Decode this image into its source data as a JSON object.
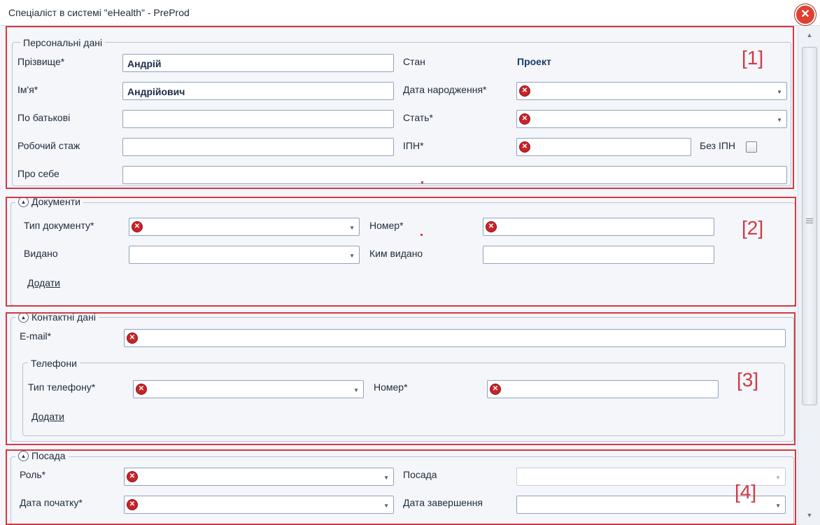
{
  "window": {
    "title": "Спеціаліст в системі \"eHealth\" - PreProd",
    "close_icon": "close-icon"
  },
  "annotations": [
    "[1]",
    "[2]",
    "[3]",
    "[4]"
  ],
  "personal": {
    "legend": "Персональні дані",
    "surname_label": "Прізвище*",
    "surname_value": "Андрій",
    "name_label": "Ім'я*",
    "name_value": "Андрійович",
    "patronymic_label": "По батькові",
    "patronymic_value": "",
    "experience_label": "Робочий стаж",
    "experience_value": "",
    "about_label": "Про себе",
    "about_value": "",
    "status_label": "Стан",
    "status_value": "Проект",
    "birthdate_label": "Дата народження*",
    "gender_label": "Стать*",
    "tax_id_label": "ІПН*",
    "no_tax_id_label": "Без ІПН",
    "no_tax_id_checked": false
  },
  "documents": {
    "legend": "Документи",
    "doc_type_label": "Тип документу*",
    "number_label": "Номер*",
    "issued_label": "Видано",
    "issued_by_label": "Ким видано",
    "add_link": "Додати"
  },
  "contacts": {
    "legend": "Контактні дані",
    "email_label": "E-mail*",
    "phones": {
      "legend": "Телефони",
      "phone_type_label": "Тип телефону*",
      "number_label": "Номер*",
      "add_link": "Додати"
    }
  },
  "position": {
    "legend": "Посада",
    "role_label": "Роль*",
    "position_label": "Посада",
    "start_date_label": "Дата початку*",
    "end_date_label": "Дата завершення"
  },
  "colors": {
    "annotation": "#d23a44",
    "error": "#c8232a",
    "accent": "#1b3a6b"
  }
}
